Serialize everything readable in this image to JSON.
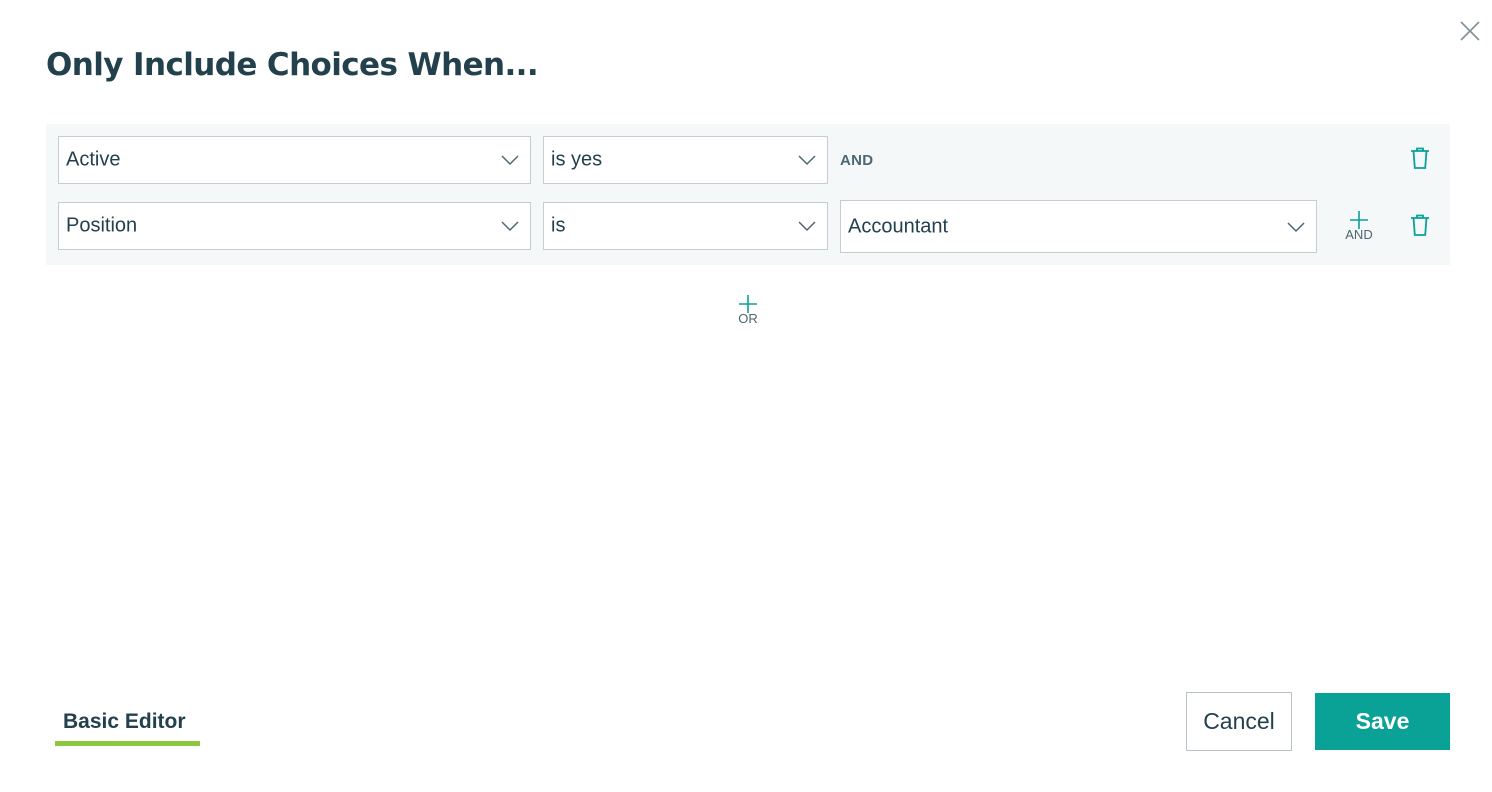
{
  "dialog": {
    "title": "Only Include Choices When...",
    "close_icon": "close-icon"
  },
  "conditions": {
    "rows": [
      {
        "field": "Active",
        "operator": "is yes",
        "connector": "AND"
      },
      {
        "field": "Position",
        "operator": "is",
        "value": "Accountant",
        "add_label": "AND"
      }
    ],
    "add_or_label": "OR"
  },
  "footer": {
    "tab_label": "Basic Editor",
    "cancel_label": "Cancel",
    "save_label": "Save"
  },
  "colors": {
    "accent": "#0aa196",
    "tab_underline": "#8dc63f",
    "text": "#23404d",
    "panel_bg": "#f4f8f9"
  }
}
